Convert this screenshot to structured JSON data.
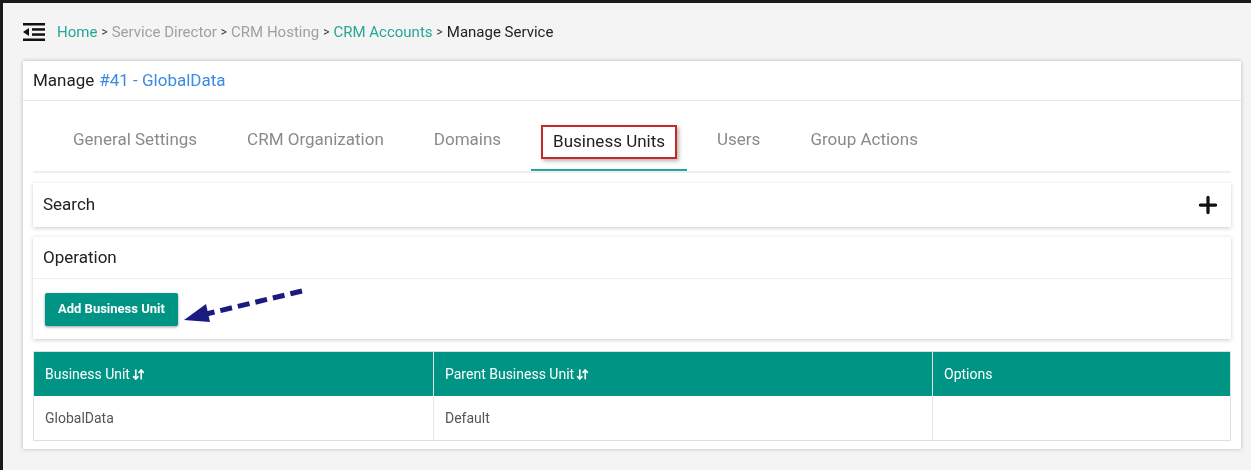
{
  "breadcrumb": [
    {
      "label": "Home",
      "kind": "link"
    },
    {
      "label": "Service Director",
      "kind": "muted"
    },
    {
      "label": "CRM Hosting",
      "kind": "muted"
    },
    {
      "label": "CRM Accounts",
      "kind": "link"
    },
    {
      "label": "Manage Service",
      "kind": "current"
    }
  ],
  "breadcrumb_separator": ">",
  "page_title": {
    "prefix": "Manage",
    "link": "#41 - GlobalData"
  },
  "tabs": [
    {
      "label": "General Settings",
      "selected": false
    },
    {
      "label": "CRM Organization",
      "selected": false
    },
    {
      "label": "Domains",
      "selected": false
    },
    {
      "label": "Business Units",
      "selected": true
    },
    {
      "label": "Users",
      "selected": false
    },
    {
      "label": "Group Actions",
      "selected": false
    }
  ],
  "search_panel": {
    "title": "Search",
    "expanded": false
  },
  "operation_panel": {
    "title": "Operation",
    "button": "Add Business Unit"
  },
  "table": {
    "columns": [
      {
        "label": "Business Unit",
        "sortable": true
      },
      {
        "label": "Parent Business Unit",
        "sortable": true
      },
      {
        "label": "Options",
        "sortable": false
      }
    ],
    "rows": [
      [
        "GlobalData",
        "Default",
        ""
      ]
    ]
  }
}
